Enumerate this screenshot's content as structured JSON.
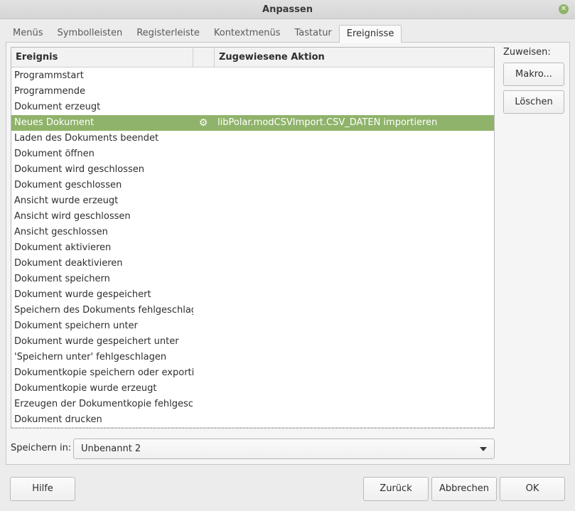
{
  "window": {
    "title": "Anpassen"
  },
  "tabs": [
    {
      "label": "Menüs"
    },
    {
      "label": "Symbolleisten"
    },
    {
      "label": "Registerleiste"
    },
    {
      "label": "Kontextmenüs"
    },
    {
      "label": "Tastatur"
    },
    {
      "label": "Ereignisse",
      "active": true
    }
  ],
  "table": {
    "columns": [
      "Ereignis",
      "",
      "Zugewiesene Aktion"
    ],
    "rows": [
      {
        "event": "Programmstart",
        "action": ""
      },
      {
        "event": "Programmende",
        "action": ""
      },
      {
        "event": "Dokument erzeugt",
        "action": ""
      },
      {
        "event": "Neues Dokument",
        "action": "libPolar.modCSVImport.CSV_DATEN importieren",
        "icon": "gear-icon",
        "selected": true
      },
      {
        "event": "Laden des Dokuments beendet",
        "action": ""
      },
      {
        "event": "Dokument öffnen",
        "action": ""
      },
      {
        "event": "Dokument wird geschlossen",
        "action": ""
      },
      {
        "event": "Dokument geschlossen",
        "action": ""
      },
      {
        "event": "Ansicht wurde erzeugt",
        "action": ""
      },
      {
        "event": "Ansicht wird geschlossen",
        "action": ""
      },
      {
        "event": "Ansicht geschlossen",
        "action": ""
      },
      {
        "event": "Dokument aktivieren",
        "action": ""
      },
      {
        "event": "Dokument deaktivieren",
        "action": ""
      },
      {
        "event": "Dokument speichern",
        "action": ""
      },
      {
        "event": "Dokument wurde gespeichert",
        "action": ""
      },
      {
        "event": "Speichern des Dokuments fehlgeschlagen",
        "action": ""
      },
      {
        "event": "Dokument speichern unter",
        "action": ""
      },
      {
        "event": "Dokument wurde gespeichert unter",
        "action": ""
      },
      {
        "event": "'Speichern unter' fehlgeschlagen",
        "action": ""
      },
      {
        "event": "Dokumentkopie speichern oder exportieren",
        "action": ""
      },
      {
        "event": "Dokumentkopie wurde erzeugt",
        "action": ""
      },
      {
        "event": "Erzeugen der Dokumentkopie fehlgeschlagen",
        "action": ""
      },
      {
        "event": "Dokument drucken",
        "action": ""
      }
    ]
  },
  "assign": {
    "label": "Zuweisen:",
    "macro_button": "Makro...",
    "delete_button": "Löschen"
  },
  "save_in": {
    "label": "Speichern in:",
    "value": "Unbenannt 2"
  },
  "footer": {
    "help": "Hilfe",
    "back": "Zurück",
    "cancel": "Abbrechen",
    "ok": "OK"
  },
  "colors": {
    "selection": "#8fb36a",
    "close_button": "#8fb36a"
  }
}
